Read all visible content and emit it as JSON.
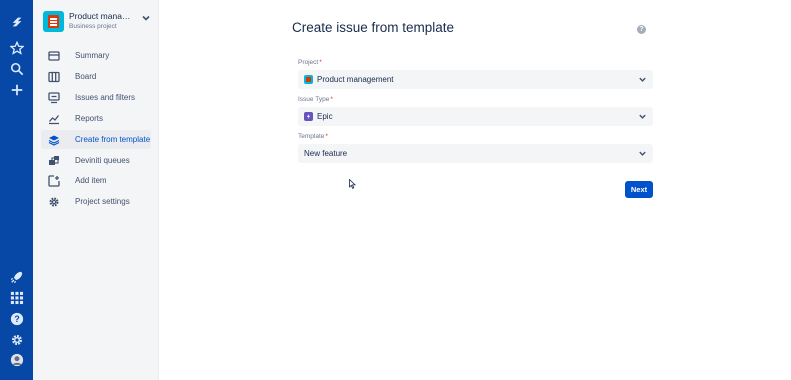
{
  "global_nav": {
    "items": [
      "jira-logo-icon",
      "star-icon",
      "search-icon",
      "plus-icon"
    ],
    "bottom_items": [
      "rocket-icon",
      "app-grid-icon",
      "help-icon",
      "settings-icon",
      "user-avatar"
    ]
  },
  "sidebar": {
    "project": {
      "name": "Product manage...",
      "type": "Business project"
    },
    "items": [
      {
        "label": "Summary",
        "icon": "summary-icon"
      },
      {
        "label": "Board",
        "icon": "board-icon"
      },
      {
        "label": "Issues and filters",
        "icon": "issues-icon"
      },
      {
        "label": "Reports",
        "icon": "reports-icon"
      },
      {
        "label": "Create from template",
        "icon": "template-stack-icon",
        "selected": true
      },
      {
        "label": "Deviniti queues",
        "icon": "queues-icon"
      },
      {
        "label": "Add item",
        "icon": "add-item-icon"
      },
      {
        "label": "Project settings",
        "icon": "gear-icon"
      }
    ]
  },
  "main": {
    "title": "Create issue from template",
    "help": "?",
    "fields": {
      "project": {
        "label": "Project",
        "value": "Product management"
      },
      "issue_type": {
        "label": "Issue Type",
        "value": "Epic"
      },
      "template": {
        "label": "Template",
        "value": "New feature"
      }
    },
    "required_marker": "*",
    "next_label": "Next"
  },
  "colors": {
    "rail": "#0747a6",
    "sidebar": "#f4f5f7",
    "primary": "#0052cc",
    "epic": "#6554c0"
  }
}
